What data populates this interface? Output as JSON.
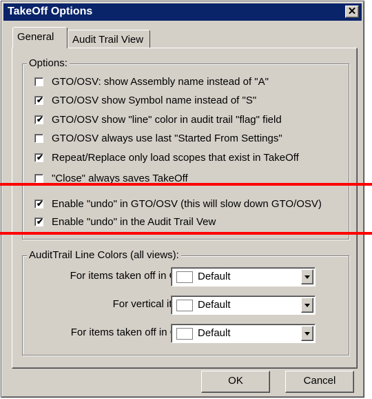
{
  "window": {
    "title": "TakeOff Options",
    "close_glyph": "✕"
  },
  "tabs": [
    {
      "label": "General",
      "active": true
    },
    {
      "label": "Audit Trail View",
      "active": false
    }
  ],
  "options": {
    "legend": "Options:",
    "items": [
      {
        "label": "GTO/OSV: show Assembly name instead of \"A\"",
        "checked": false
      },
      {
        "label": "GTO/OSV show Symbol name instead of \"S\"",
        "checked": true
      },
      {
        "label": "GTO/OSV show \"line\" color in audit trail \"flag\" field",
        "checked": true
      },
      {
        "label": "GTO/OSV always use last \"Started From Settings\"",
        "checked": false
      },
      {
        "label": "Repeat/Replace only load scopes that exist in TakeOff",
        "checked": true
      },
      {
        "label": "\"Close\" always saves TakeOff",
        "checked": false
      },
      {
        "label": "Enable \"undo\" in GTO/OSV (this will slow down GTO/OSV)",
        "checked": true
      },
      {
        "label": "Enable \"undo\" in the Audit Trail Vew",
        "checked": true
      }
    ]
  },
  "line_colors": {
    "legend": "AuditTrail Line Colors (all views):",
    "rows": [
      {
        "label": "For items taken off in GTO:",
        "value": "Default"
      },
      {
        "label": "For vertical items:",
        "value": "Default"
      },
      {
        "label": "For items taken off in OSV:",
        "value": "Default"
      }
    ]
  },
  "buttons": {
    "ok": "OK",
    "cancel": "Cancel"
  },
  "checkmark_glyph": "✔",
  "colors": {
    "titlebar": "#0a246a",
    "face": "#d4d0c8",
    "annotation": "#ff0000"
  }
}
